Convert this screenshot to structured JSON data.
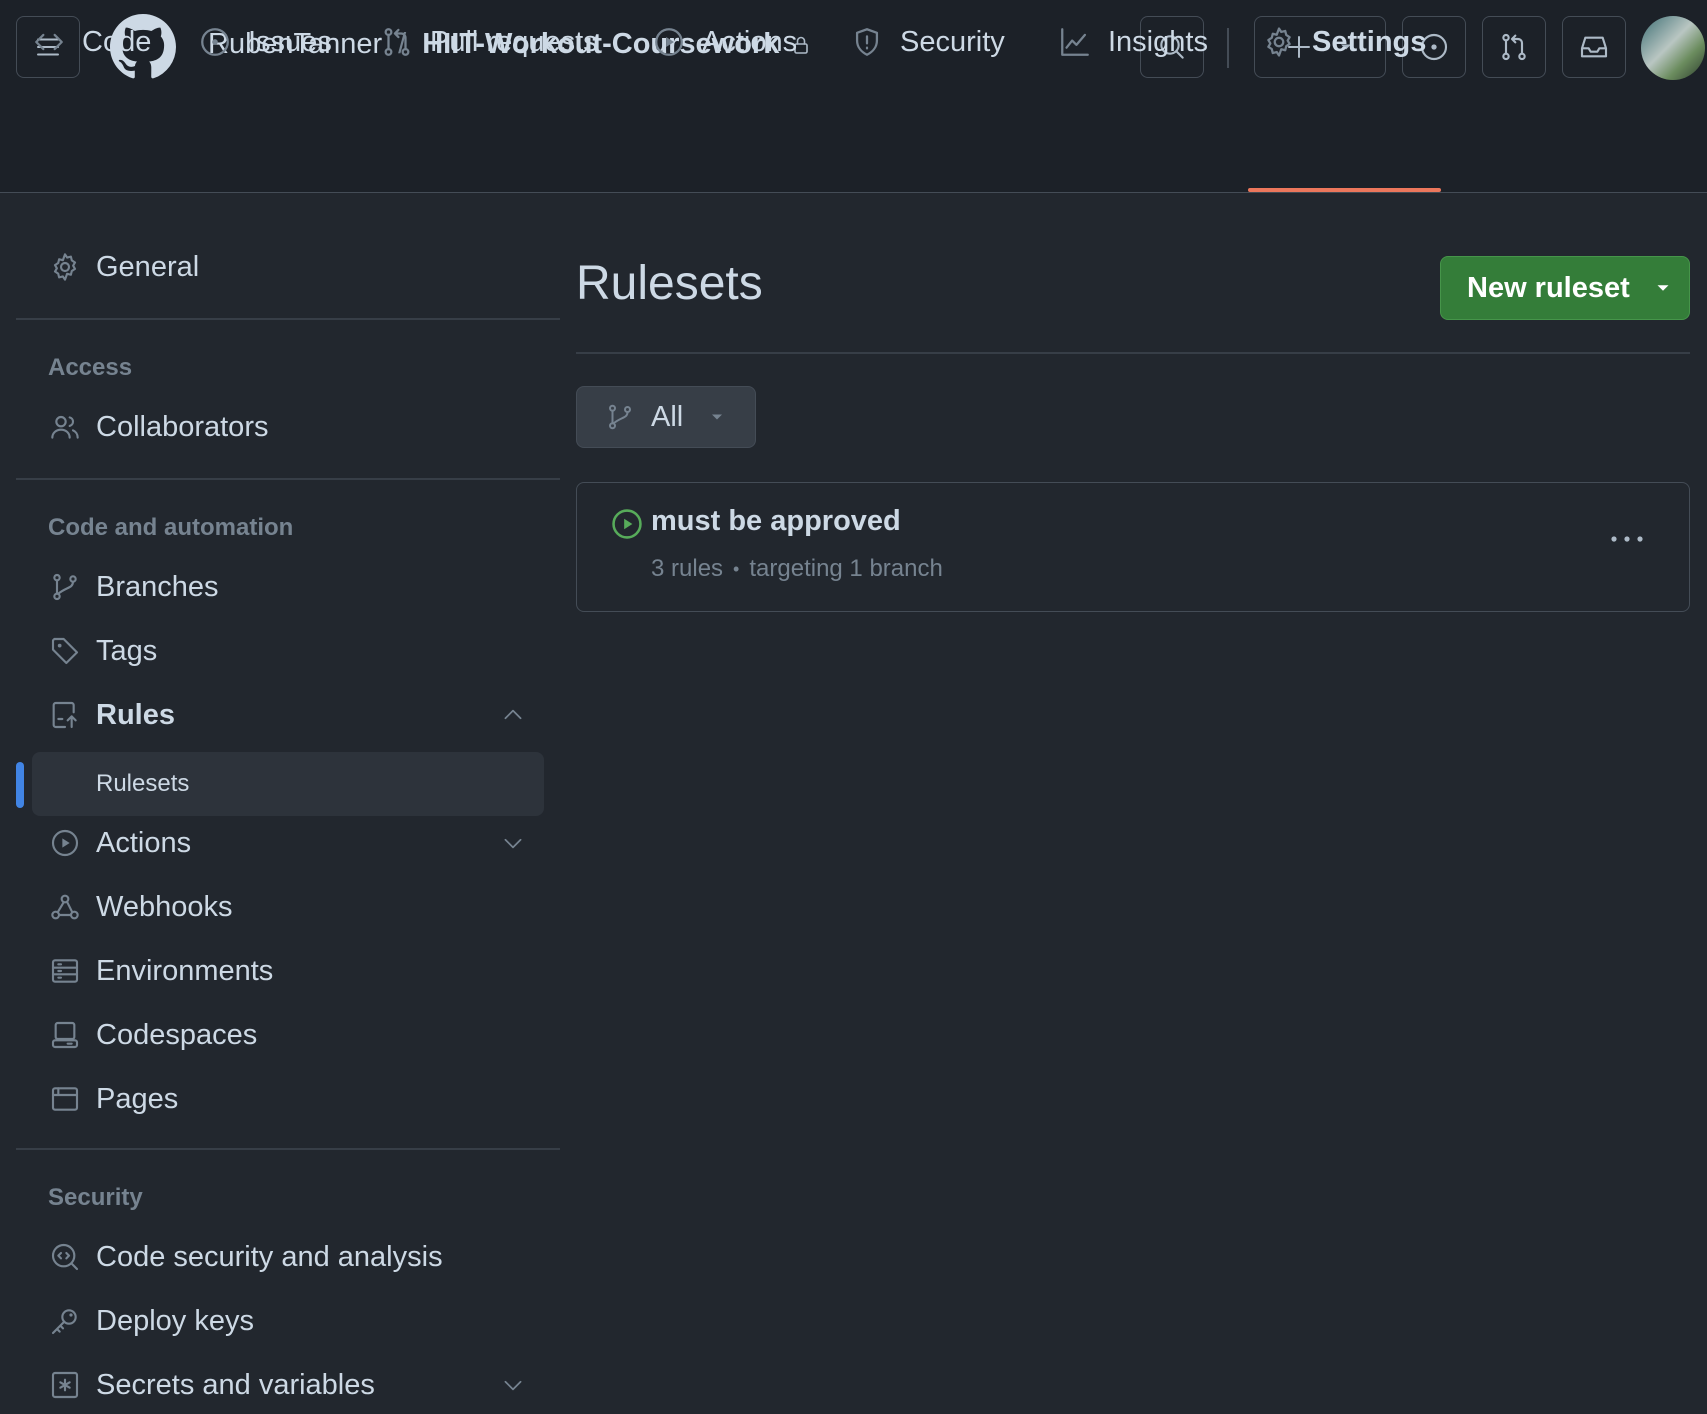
{
  "header": {
    "owner": "RubenTanner",
    "separator": "/",
    "repo": "HIIT-Workout-Coursework"
  },
  "tabs": [
    {
      "label": "Code",
      "icon": "code-icon"
    },
    {
      "label": "Issues",
      "icon": "issue-opened-icon"
    },
    {
      "label": "Pull requests",
      "icon": "git-pull-request-icon"
    },
    {
      "label": "Actions",
      "icon": "play-icon"
    },
    {
      "label": "Security",
      "icon": "shield-icon"
    },
    {
      "label": "Insights",
      "icon": "graph-icon"
    },
    {
      "label": "Settings",
      "icon": "gear-icon",
      "active": true
    }
  ],
  "sidebar": {
    "general": "General",
    "access_heading": "Access",
    "collaborators": "Collaborators",
    "code_heading": "Code and automation",
    "branches": "Branches",
    "tags": "Tags",
    "rules": "Rules",
    "rulesets": "Rulesets",
    "actions": "Actions",
    "webhooks": "Webhooks",
    "environments": "Environments",
    "codespaces": "Codespaces",
    "pages": "Pages",
    "security_heading": "Security",
    "code_security": "Code security and analysis",
    "deploy_keys": "Deploy keys",
    "secrets": "Secrets and variables"
  },
  "main": {
    "title": "Rulesets",
    "new_button": "New ruleset",
    "filter_label": "All",
    "ruleset": {
      "name": "must be approved",
      "rules_count": "3 rules",
      "targeting": "targeting 1 branch"
    }
  },
  "colors": {
    "background": "#22272e",
    "header_bg": "#1c2128",
    "accent_underline": "#ec775c",
    "primary_button": "#347d39",
    "active_indicator": "#4184e4",
    "active_status": "#57ab5a"
  }
}
